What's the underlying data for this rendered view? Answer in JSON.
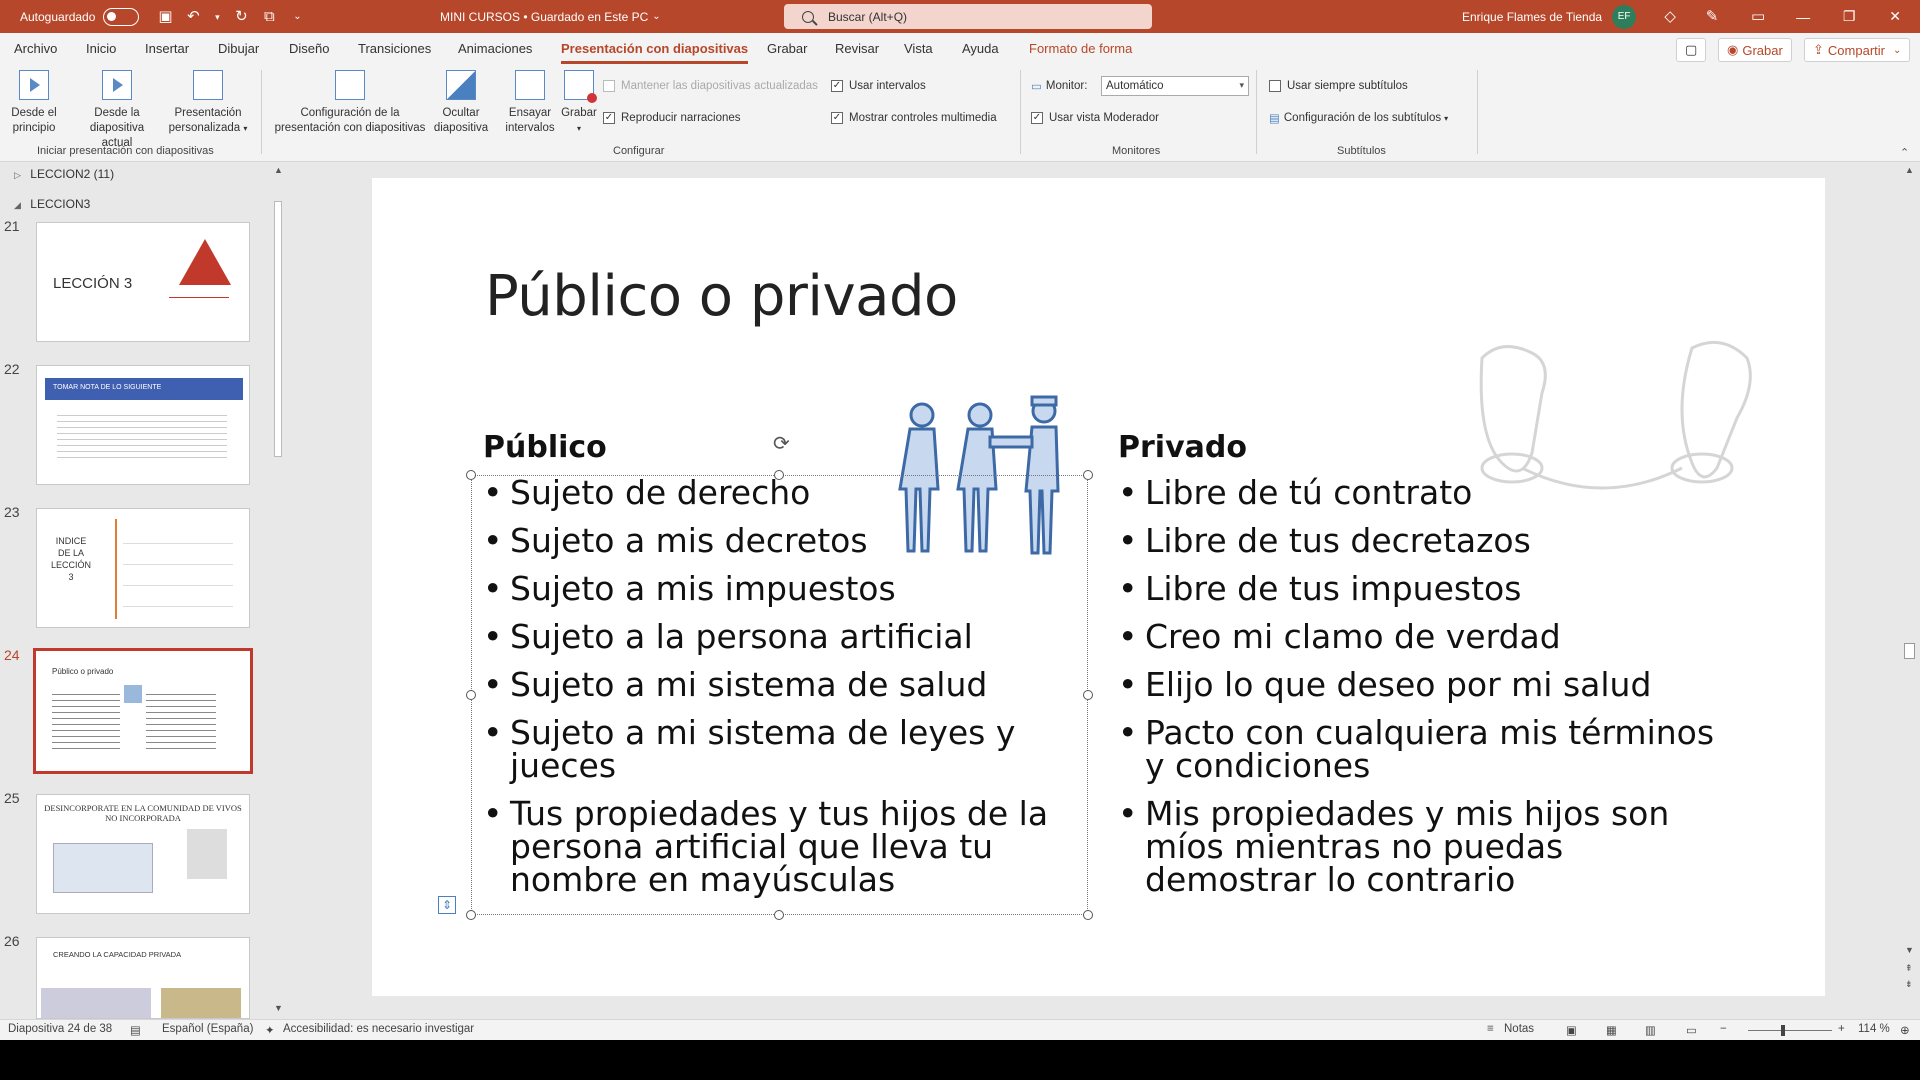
{
  "titlebar": {
    "autosave_label": "Autoguardado",
    "doc_title": "MINI CURSOS • Guardado en Este PC",
    "search_placeholder": "Buscar (Alt+Q)",
    "user_name": "Enrique Flames de Tienda",
    "user_initials": "EF",
    "accent_color": "#b7472a"
  },
  "menu": {
    "tabs": [
      "Archivo",
      "Inicio",
      "Insertar",
      "Dibujar",
      "Diseño",
      "Transiciones",
      "Animaciones",
      "Presentación con diapositivas",
      "Grabar",
      "Revisar",
      "Vista",
      "Ayuda",
      "Formato de forma"
    ],
    "active_tab": "Presentación con diapositivas",
    "record_button": "Grabar",
    "share_button": "Compartir"
  },
  "ribbon": {
    "start_group": {
      "label": "Iniciar presentación con diapositivas",
      "from_start": [
        "Desde el",
        "principio"
      ],
      "from_current": [
        "Desde la",
        "diapositiva actual"
      ],
      "custom": [
        "Presentación",
        "personalizada"
      ]
    },
    "config_group": {
      "label": "Configurar",
      "setup": [
        "Configuración de la",
        "presentación con diapositivas"
      ],
      "hide": [
        "Ocultar",
        "diapositiva"
      ],
      "rehearse": [
        "Ensayar",
        "intervalos"
      ],
      "record": [
        "Grabar",
        ""
      ],
      "keep_updated": "Mantener las diapositivas actualizadas",
      "play_narrations": "Reproducir narraciones",
      "use_timings": "Usar intervalos",
      "show_media_controls": "Mostrar controles multimedia"
    },
    "monitors_group": {
      "label": "Monitores",
      "monitor_label": "Monitor:",
      "monitor_value": "Automático",
      "presenter_view": "Usar vista Moderador"
    },
    "subtitles_group": {
      "label": "Subtítulos",
      "always_subtitles": "Usar siempre subtítulos",
      "subtitle_settings": "Configuración de los subtítulos"
    }
  },
  "thumbnails": {
    "sections": [
      "LECCION2 (11)",
      "LECCION3"
    ],
    "slides": [
      {
        "num": "21",
        "text": "LECCIÓN 3"
      },
      {
        "num": "22",
        "text": "TOMAR NOTA DE LO SIGUIENTE"
      },
      {
        "num": "23",
        "text": "INDICE DE LA LECCIÓN 3"
      },
      {
        "num": "24",
        "text": "Público o privado"
      },
      {
        "num": "25",
        "text": "DESINCORPORATE EN LA COMUNIDAD DE VIVOS NO INCORPORADA"
      },
      {
        "num": "26",
        "text": "CREANDO LA CAPACIDAD PRIVADA"
      }
    ],
    "selected": "24"
  },
  "slide": {
    "title": "Público o privado",
    "left": {
      "heading": "Público",
      "items": [
        "Sujeto de derecho",
        "Sujeto a mis decretos",
        "Sujeto a mis impuestos",
        "Sujeto a la persona artificial",
        "Sujeto a mi sistema de salud",
        "Sujeto a mi sistema de leyes y jueces",
        "Tus propiedades y tus hijos de la persona artificial que lleva tu nombre en mayúsculas"
      ]
    },
    "right": {
      "heading": "Privado",
      "items": [
        "Libre de tú contrato",
        "Libre de tus decretazos",
        "Libre de tus impuestos",
        "Creo mi clamo de verdad",
        "Elijo lo que deseo por mi salud",
        "Pacto con cualquiera mis términos y condiciones",
        "Mis propiedades y mis hijos son míos mientras no puedas demostrar lo contrario"
      ]
    }
  },
  "statusbar": {
    "slide_counter": "Diapositiva 24 de 38",
    "language": "Español (España)",
    "accessibility": "Accesibilidad: es necesario investigar",
    "notes": "Notas",
    "zoom": "114 %"
  }
}
